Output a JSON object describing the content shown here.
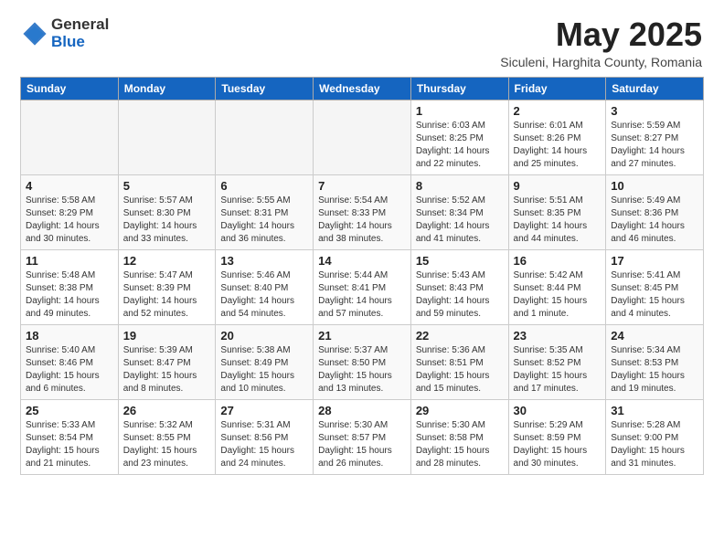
{
  "logo": {
    "general": "General",
    "blue": "Blue"
  },
  "title": "May 2025",
  "subtitle": "Siculeni, Harghita County, Romania",
  "days_of_week": [
    "Sunday",
    "Monday",
    "Tuesday",
    "Wednesday",
    "Thursday",
    "Friday",
    "Saturday"
  ],
  "weeks": [
    [
      {
        "day": "",
        "info": ""
      },
      {
        "day": "",
        "info": ""
      },
      {
        "day": "",
        "info": ""
      },
      {
        "day": "",
        "info": ""
      },
      {
        "day": "1",
        "info": "Sunrise: 6:03 AM\nSunset: 8:25 PM\nDaylight: 14 hours\nand 22 minutes."
      },
      {
        "day": "2",
        "info": "Sunrise: 6:01 AM\nSunset: 8:26 PM\nDaylight: 14 hours\nand 25 minutes."
      },
      {
        "day": "3",
        "info": "Sunrise: 5:59 AM\nSunset: 8:27 PM\nDaylight: 14 hours\nand 27 minutes."
      }
    ],
    [
      {
        "day": "4",
        "info": "Sunrise: 5:58 AM\nSunset: 8:29 PM\nDaylight: 14 hours\nand 30 minutes."
      },
      {
        "day": "5",
        "info": "Sunrise: 5:57 AM\nSunset: 8:30 PM\nDaylight: 14 hours\nand 33 minutes."
      },
      {
        "day": "6",
        "info": "Sunrise: 5:55 AM\nSunset: 8:31 PM\nDaylight: 14 hours\nand 36 minutes."
      },
      {
        "day": "7",
        "info": "Sunrise: 5:54 AM\nSunset: 8:33 PM\nDaylight: 14 hours\nand 38 minutes."
      },
      {
        "day": "8",
        "info": "Sunrise: 5:52 AM\nSunset: 8:34 PM\nDaylight: 14 hours\nand 41 minutes."
      },
      {
        "day": "9",
        "info": "Sunrise: 5:51 AM\nSunset: 8:35 PM\nDaylight: 14 hours\nand 44 minutes."
      },
      {
        "day": "10",
        "info": "Sunrise: 5:49 AM\nSunset: 8:36 PM\nDaylight: 14 hours\nand 46 minutes."
      }
    ],
    [
      {
        "day": "11",
        "info": "Sunrise: 5:48 AM\nSunset: 8:38 PM\nDaylight: 14 hours\nand 49 minutes."
      },
      {
        "day": "12",
        "info": "Sunrise: 5:47 AM\nSunset: 8:39 PM\nDaylight: 14 hours\nand 52 minutes."
      },
      {
        "day": "13",
        "info": "Sunrise: 5:46 AM\nSunset: 8:40 PM\nDaylight: 14 hours\nand 54 minutes."
      },
      {
        "day": "14",
        "info": "Sunrise: 5:44 AM\nSunset: 8:41 PM\nDaylight: 14 hours\nand 57 minutes."
      },
      {
        "day": "15",
        "info": "Sunrise: 5:43 AM\nSunset: 8:43 PM\nDaylight: 14 hours\nand 59 minutes."
      },
      {
        "day": "16",
        "info": "Sunrise: 5:42 AM\nSunset: 8:44 PM\nDaylight: 15 hours\nand 1 minute."
      },
      {
        "day": "17",
        "info": "Sunrise: 5:41 AM\nSunset: 8:45 PM\nDaylight: 15 hours\nand 4 minutes."
      }
    ],
    [
      {
        "day": "18",
        "info": "Sunrise: 5:40 AM\nSunset: 8:46 PM\nDaylight: 15 hours\nand 6 minutes."
      },
      {
        "day": "19",
        "info": "Sunrise: 5:39 AM\nSunset: 8:47 PM\nDaylight: 15 hours\nand 8 minutes."
      },
      {
        "day": "20",
        "info": "Sunrise: 5:38 AM\nSunset: 8:49 PM\nDaylight: 15 hours\nand 10 minutes."
      },
      {
        "day": "21",
        "info": "Sunrise: 5:37 AM\nSunset: 8:50 PM\nDaylight: 15 hours\nand 13 minutes."
      },
      {
        "day": "22",
        "info": "Sunrise: 5:36 AM\nSunset: 8:51 PM\nDaylight: 15 hours\nand 15 minutes."
      },
      {
        "day": "23",
        "info": "Sunrise: 5:35 AM\nSunset: 8:52 PM\nDaylight: 15 hours\nand 17 minutes."
      },
      {
        "day": "24",
        "info": "Sunrise: 5:34 AM\nSunset: 8:53 PM\nDaylight: 15 hours\nand 19 minutes."
      }
    ],
    [
      {
        "day": "25",
        "info": "Sunrise: 5:33 AM\nSunset: 8:54 PM\nDaylight: 15 hours\nand 21 minutes."
      },
      {
        "day": "26",
        "info": "Sunrise: 5:32 AM\nSunset: 8:55 PM\nDaylight: 15 hours\nand 23 minutes."
      },
      {
        "day": "27",
        "info": "Sunrise: 5:31 AM\nSunset: 8:56 PM\nDaylight: 15 hours\nand 24 minutes."
      },
      {
        "day": "28",
        "info": "Sunrise: 5:30 AM\nSunset: 8:57 PM\nDaylight: 15 hours\nand 26 minutes."
      },
      {
        "day": "29",
        "info": "Sunrise: 5:30 AM\nSunset: 8:58 PM\nDaylight: 15 hours\nand 28 minutes."
      },
      {
        "day": "30",
        "info": "Sunrise: 5:29 AM\nSunset: 8:59 PM\nDaylight: 15 hours\nand 30 minutes."
      },
      {
        "day": "31",
        "info": "Sunrise: 5:28 AM\nSunset: 9:00 PM\nDaylight: 15 hours\nand 31 minutes."
      }
    ]
  ]
}
